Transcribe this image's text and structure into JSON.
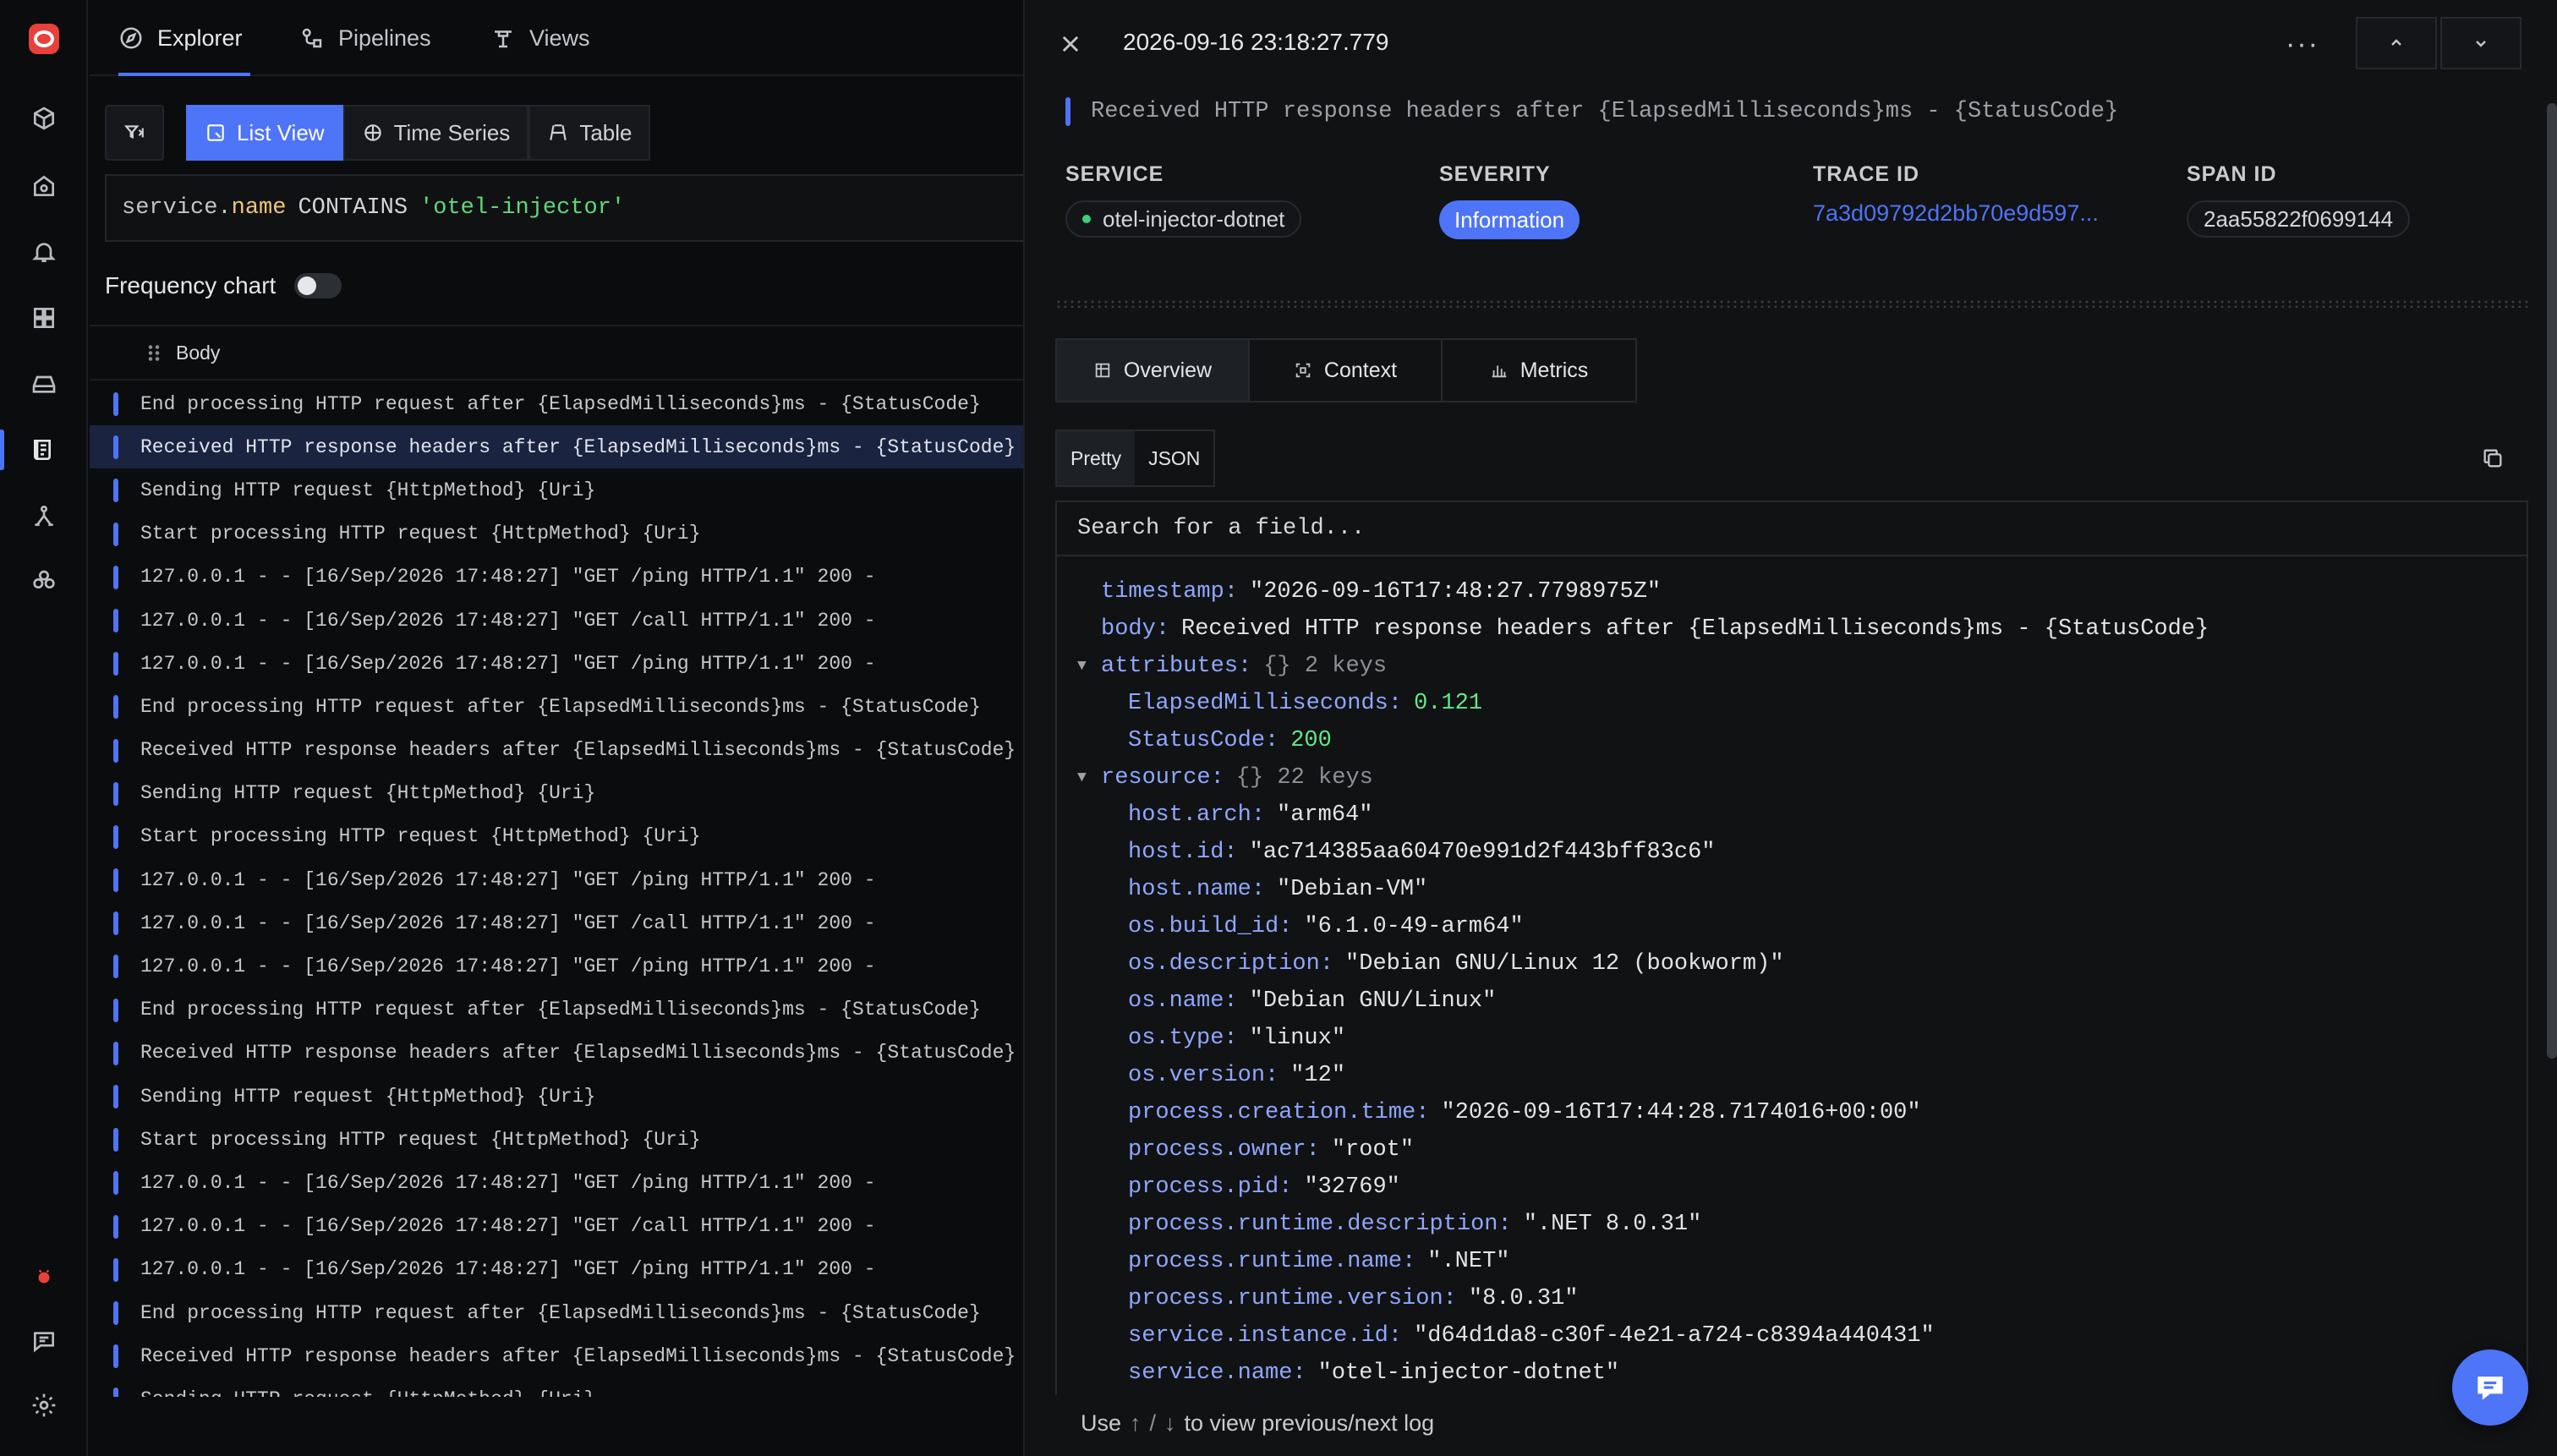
{
  "nav": {
    "tabs": [
      {
        "label": "Explorer",
        "icon": "compass-icon"
      },
      {
        "label": "Pipelines",
        "icon": "pipeline-icon"
      },
      {
        "label": "Views",
        "icon": "views-icon"
      }
    ]
  },
  "view_modes": [
    {
      "label": "List View",
      "icon": "list-view-icon"
    },
    {
      "label": "Time Series",
      "icon": "time-series-icon"
    },
    {
      "label": "Table",
      "icon": "table-icon"
    }
  ],
  "query": {
    "key_prefix": "service.",
    "key_suffix": "name",
    "operator": "CONTAINS",
    "value": "'otel-injector'"
  },
  "frequency_chart": {
    "label": "Frequency chart",
    "enabled": false
  },
  "table": {
    "column": "Body"
  },
  "log_rows": [
    "End processing HTTP request after {ElapsedMilliseconds}ms - {StatusCode}",
    "Received HTTP response headers after {ElapsedMilliseconds}ms - {StatusCode}",
    "Sending HTTP request {HttpMethod} {Uri}",
    "Start processing HTTP request {HttpMethod} {Uri}",
    "127.0.0.1 - - [16/Sep/2026 17:48:27] \"GET /ping HTTP/1.1\" 200 -",
    "127.0.0.1 - - [16/Sep/2026 17:48:27] \"GET /call HTTP/1.1\" 200 -",
    "127.0.0.1 - - [16/Sep/2026 17:48:27] \"GET /ping HTTP/1.1\" 200 -",
    "End processing HTTP request after {ElapsedMilliseconds}ms - {StatusCode}",
    "Received HTTP response headers after {ElapsedMilliseconds}ms - {StatusCode}",
    "Sending HTTP request {HttpMethod} {Uri}",
    "Start processing HTTP request {HttpMethod} {Uri}",
    "127.0.0.1 - - [16/Sep/2026 17:48:27] \"GET /ping HTTP/1.1\" 200 -",
    "127.0.0.1 - - [16/Sep/2026 17:48:27] \"GET /call HTTP/1.1\" 200 -",
    "127.0.0.1 - - [16/Sep/2026 17:48:27] \"GET /ping HTTP/1.1\" 200 -",
    "End processing HTTP request after {ElapsedMilliseconds}ms - {StatusCode}",
    "Received HTTP response headers after {ElapsedMilliseconds}ms - {StatusCode}",
    "Sending HTTP request {HttpMethod} {Uri}",
    "Start processing HTTP request {HttpMethod} {Uri}",
    "127.0.0.1 - - [16/Sep/2026 17:48:27] \"GET /ping HTTP/1.1\" 200 -",
    "127.0.0.1 - - [16/Sep/2026 17:48:27] \"GET /call HTTP/1.1\" 200 -",
    "127.0.0.1 - - [16/Sep/2026 17:48:27] \"GET /ping HTTP/1.1\" 200 -",
    "End processing HTTP request after {ElapsedMilliseconds}ms - {StatusCode}",
    "Received HTTP response headers after {ElapsedMilliseconds}ms - {StatusCode}",
    "Sending HTTP request {HttpMethod} {Uri}"
  ],
  "selected_row": 1,
  "detail": {
    "timestamp": "2026-09-16 23:18:27.779",
    "more_label": "···",
    "body": "Received HTTP response headers after {ElapsedMilliseconds}ms - {StatusCode}",
    "service_header": "SERVICE",
    "service": "otel-injector-dotnet",
    "severity_header": "SEVERITY",
    "severity": "Information",
    "trace_header": "TRACE ID",
    "trace_id": "7a3d09792d2bb70e9d597...",
    "span_header": "SPAN ID",
    "span_id": "2aa55822f0699144",
    "tabs": [
      {
        "label": "Overview",
        "icon": "grid-icon"
      },
      {
        "label": "Context",
        "icon": "context-icon"
      },
      {
        "label": "Metrics",
        "icon": "metrics-icon"
      }
    ],
    "format": [
      "Pretty",
      "JSON"
    ],
    "search_placeholder": "Search for a field...",
    "fields": {
      "timestamp_key": "timestamp",
      "timestamp_val": "\"2026-09-16T17:48:27.7798975Z\"",
      "body_key": "body",
      "body_val": "Received HTTP response headers after {ElapsedMilliseconds}ms - {StatusCode}",
      "attributes_key": "attributes",
      "attributes_meta": "{} 2 keys",
      "attributes": [
        {
          "k": "ElapsedMilliseconds",
          "v": "0.121"
        },
        {
          "k": "StatusCode",
          "v": "200"
        }
      ],
      "resource_key": "resource",
      "resource_meta": "{} 22 keys",
      "resource": [
        {
          "k": "host.arch",
          "v": "\"arm64\""
        },
        {
          "k": "host.id",
          "v": "\"ac714385aa60470e991d2f443bff83c6\""
        },
        {
          "k": "host.name",
          "v": "\"Debian-VM\""
        },
        {
          "k": "os.build_id",
          "v": "\"6.1.0-49-arm64\""
        },
        {
          "k": "os.description",
          "v": "\"Debian GNU/Linux 12 (bookworm)\""
        },
        {
          "k": "os.name",
          "v": "\"Debian GNU/Linux\""
        },
        {
          "k": "os.type",
          "v": "\"linux\""
        },
        {
          "k": "os.version",
          "v": "\"12\""
        },
        {
          "k": "process.creation.time",
          "v": "\"2026-09-16T17:44:28.7174016+00:00\""
        },
        {
          "k": "process.owner",
          "v": "\"root\""
        },
        {
          "k": "process.pid",
          "v": "\"32769\""
        },
        {
          "k": "process.runtime.description",
          "v": "\".NET 8.0.31\""
        },
        {
          "k": "process.runtime.name",
          "v": "\".NET\""
        },
        {
          "k": "process.runtime.version",
          "v": "\"8.0.31\""
        },
        {
          "k": "service.instance.id",
          "v": "\"d64d1da8-c30f-4e21-a724-c8394a440431\""
        },
        {
          "k": "service.name",
          "v": "\"otel-injector-dotnet\""
        }
      ]
    },
    "footer": {
      "prefix": "Use",
      "up": "↑",
      "slash": "/",
      "down": "↓",
      "suffix": "to view previous/next log"
    }
  },
  "colors": {
    "accent": "#4e74f8",
    "background": "#0b0c0e",
    "panel": "#111214",
    "success": "#3ecf74"
  }
}
